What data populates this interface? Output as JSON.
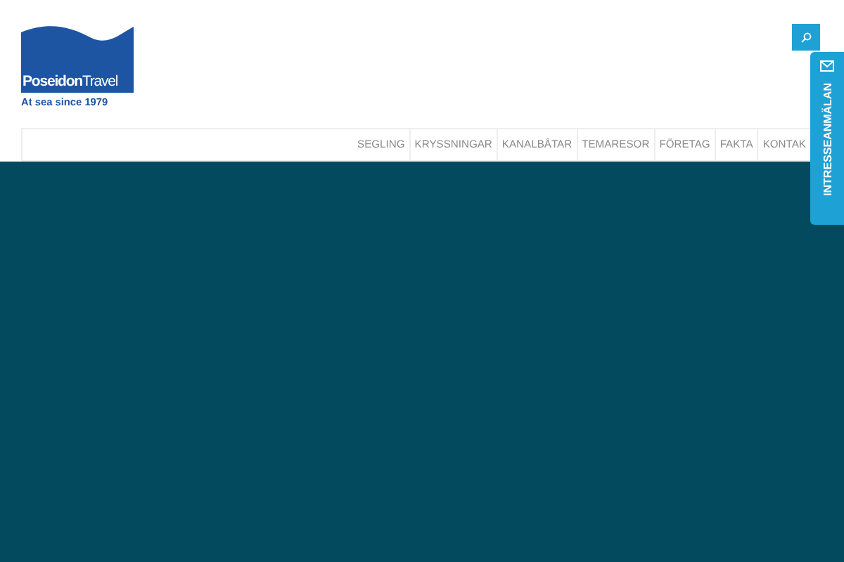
{
  "logo": {
    "name": "**Poseidon**Travel",
    "tagline": "At sea since 1979"
  },
  "nav": {
    "items": [
      {
        "label": "SEGLING"
      },
      {
        "label": "KRYSSNINGAR"
      },
      {
        "label": "KANALBÅTAR"
      },
      {
        "label": "TEMARESOR"
      },
      {
        "label": "FÖRETAG"
      },
      {
        "label": "FAKTA"
      },
      {
        "label": "KONTAK"
      }
    ]
  },
  "side_tab": {
    "label": "INTRESSEANMÄLAN"
  }
}
